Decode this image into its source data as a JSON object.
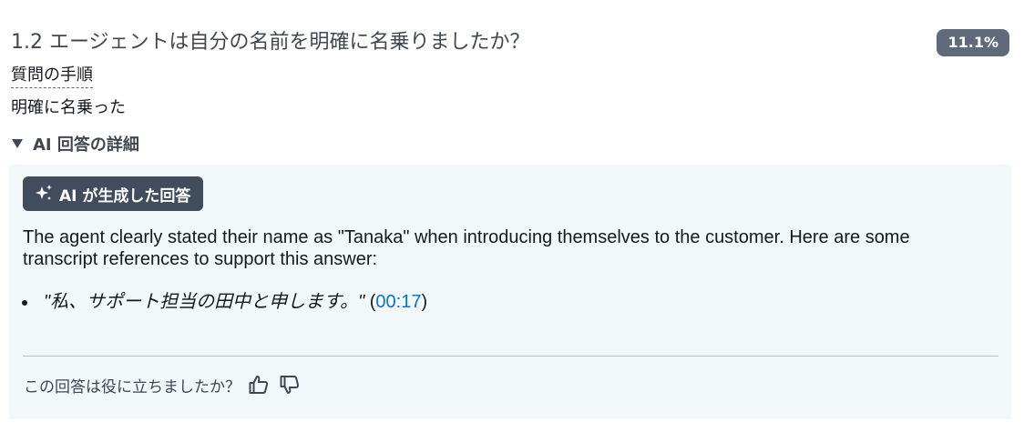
{
  "question": {
    "title": "1.2 エージェントは自分の名前を明確に名乗りましたか？",
    "score_badge": "11.1%"
  },
  "procedure_label": "質問の手順",
  "answer": "明確に名乗った",
  "details": {
    "toggle_label": "AI 回答の詳細",
    "ai_badge_label": "AI が生成した回答",
    "response_text": "The agent clearly stated their name as \"Tanaka\" when introducing themselves to the customer. Here are some transcript references to support this answer:",
    "references": [
      {
        "quote": "\"私、サポート担当の田中と申します。\"",
        "open_paren": " (",
        "timestamp": "00:17",
        "close_paren": ")"
      }
    ],
    "feedback_prompt": "この回答は役に立ちましたか？"
  },
  "icons": {
    "caret": "caret-down-icon",
    "sparkle": "sparkle-icon",
    "thumbs_up": "thumbs-up-icon",
    "thumbs_down": "thumbs-down-icon"
  },
  "colors": {
    "badge_bg": "#5f6b7a",
    "ai_badge_bg": "#414d5c",
    "panel_bg": "#f2f7fa",
    "link": "#0972d3"
  }
}
